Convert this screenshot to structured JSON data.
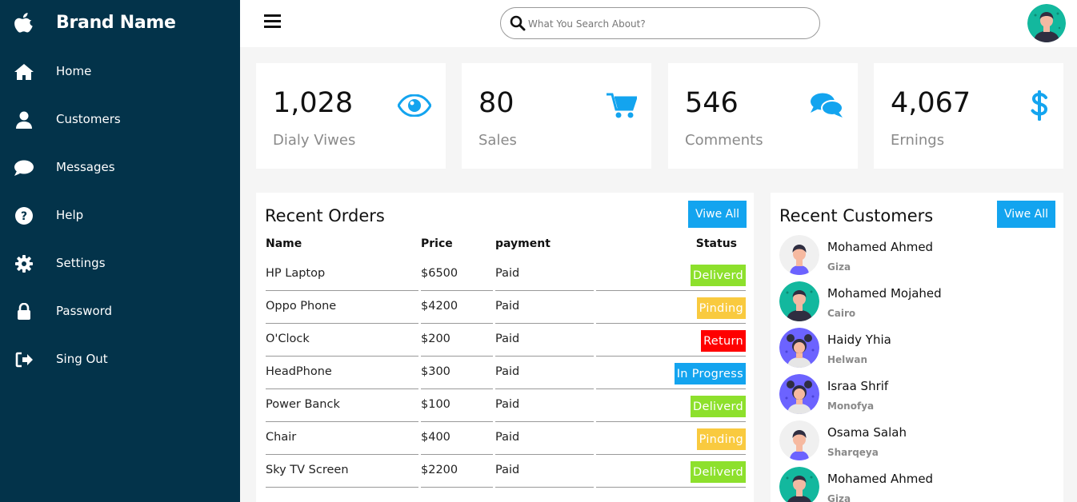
{
  "brand": {
    "name": "Brand Name",
    "logo_icon": "apple-icon"
  },
  "sidebar": {
    "items": [
      {
        "label": "Home",
        "icon": "home-icon"
      },
      {
        "label": "Customers",
        "icon": "user-icon"
      },
      {
        "label": "Messages",
        "icon": "chat-icon"
      },
      {
        "label": "Help",
        "icon": "help-icon"
      },
      {
        "label": "Settings",
        "icon": "gear-icon"
      },
      {
        "label": "Password",
        "icon": "lock-icon"
      },
      {
        "label": "Sing Out",
        "icon": "sign-out-icon"
      }
    ]
  },
  "topbar": {
    "search_placeholder": "What You Search About?",
    "search_value": ""
  },
  "cards": [
    {
      "number": "1,028",
      "label": "Dialy Viwes",
      "icon": "eye-icon"
    },
    {
      "number": "80",
      "label": "Sales",
      "icon": "cart-icon"
    },
    {
      "number": "546",
      "label": "Comments",
      "icon": "comments-icon"
    },
    {
      "number": "4,067",
      "label": "Ernings",
      "icon": "dollar-icon"
    }
  ],
  "orders": {
    "title": "Recent Orders",
    "view_all": "Viwe All",
    "headers": {
      "name": "Name",
      "price": "Price",
      "payment": "payment",
      "status": "Status"
    },
    "rows": [
      {
        "name": "HP Laptop",
        "price": "$6500",
        "payment": "Paid",
        "status": "Deliverd",
        "color": "#8de02c"
      },
      {
        "name": "Oppo Phone",
        "price": "$4200",
        "payment": "Paid",
        "status": "Pinding",
        "color": "#f9ca3f"
      },
      {
        "name": "O'Clock",
        "price": "$200",
        "payment": "Paid",
        "status": "Return",
        "color": "#f00"
      },
      {
        "name": "HeadPhone",
        "price": "$300",
        "payment": "Paid",
        "status": "In Progress",
        "color": "#1795ce"
      },
      {
        "name": "Power Banck",
        "price": "$100",
        "payment": "Paid",
        "status": "Deliverd",
        "color": "#8de02c"
      },
      {
        "name": "Chair",
        "price": "$400",
        "payment": "Paid",
        "status": "Pinding",
        "color": "#f9ca3f"
      },
      {
        "name": "Sky TV Screen",
        "price": "$2200",
        "payment": "Paid",
        "status": "Deliverd",
        "color": "#8de02c"
      }
    ]
  },
  "customers": {
    "title": "Recent Customers",
    "view_all": "Viwe All",
    "items": [
      {
        "name": "Mohamed Ahmed",
        "city": "Giza",
        "avatar": "man-light"
      },
      {
        "name": "Mohamed Mojahed",
        "city": "Cairo",
        "avatar": "man-green"
      },
      {
        "name": "Haidy Yhia",
        "city": "Helwan",
        "avatar": "woman-purple"
      },
      {
        "name": "Israa Shrif",
        "city": "Monofya",
        "avatar": "woman-purple"
      },
      {
        "name": "Osama Salah",
        "city": "Sharqeya",
        "avatar": "man-light"
      },
      {
        "name": "Mohamed Ahmed",
        "city": "Giza",
        "avatar": "man-green"
      }
    ]
  },
  "colors": {
    "sidebar": "#03334a",
    "accent": "#13a4ef",
    "delivered": "#8de02c",
    "pending": "#f9ca3f",
    "return": "#ff0000",
    "progress": "#1795ce"
  }
}
